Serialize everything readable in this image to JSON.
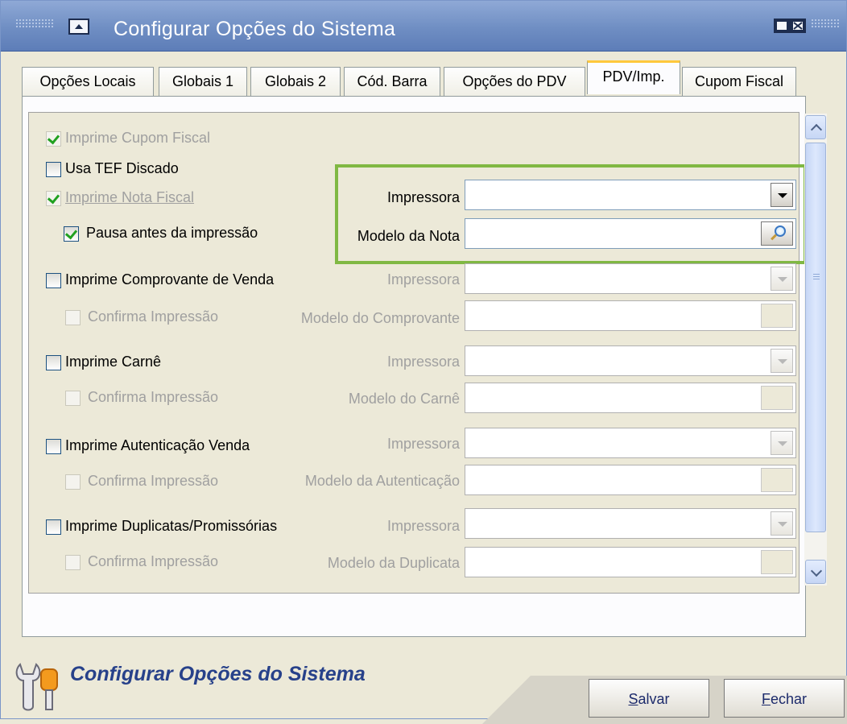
{
  "window": {
    "title": "Configurar Opções do Sistema"
  },
  "tabs": [
    {
      "label": "Opções Locais",
      "active": false
    },
    {
      "label": "Globais 1",
      "active": false
    },
    {
      "label": "Globais 2",
      "active": false
    },
    {
      "label": "Cód. Barra",
      "active": false
    },
    {
      "label": "Opções do PDV",
      "active": false
    },
    {
      "label": "PDV/Imp.",
      "active": true
    },
    {
      "label": "Cupom Fiscal",
      "active": false
    }
  ],
  "options": {
    "imprime_cupom_fiscal": {
      "label": "Imprime Cupom Fiscal",
      "checked": true,
      "enabled": false
    },
    "usa_tef_discado": {
      "label": "Usa TEF Discado",
      "checked": false,
      "enabled": true
    },
    "imprime_nota_fiscal": {
      "label": "Imprime Nota Fiscal",
      "checked": true,
      "enabled": false
    },
    "pausa_antes": {
      "label": "Pausa antes da impressão",
      "checked": true,
      "enabled": true
    },
    "nota_impressora_label": "Impressora",
    "nota_modelo_label": "Modelo da Nota",
    "nota_impressora_value": "",
    "nota_modelo_value": "",
    "comprovante": {
      "label": "Imprime Comprovante de Venda",
      "checked": false
    },
    "comprovante_confirma": {
      "label": "Confirma Impressão",
      "checked": false
    },
    "comprovante_impressora_label": "Impressora",
    "comprovante_modelo_label": "Modelo do Comprovante",
    "carne": {
      "label": "Imprime Carnê",
      "checked": false
    },
    "carne_confirma": {
      "label": "Confirma Impressão",
      "checked": false
    },
    "carne_impressora_label": "Impressora",
    "carne_modelo_label": "Modelo do Carnê",
    "autenticacao": {
      "label": "Imprime Autenticação Venda",
      "checked": false
    },
    "autenticacao_confirma": {
      "label": "Confirma Impressão",
      "checked": false
    },
    "autenticacao_impressora_label": "Impressora",
    "autenticacao_modelo_label": "Modelo da Autenticação",
    "duplicatas": {
      "label": "Imprime Duplicatas/Promissórias",
      "checked": false
    },
    "duplicatas_confirma": {
      "label": "Confirma Impressão",
      "checked": false
    },
    "duplicatas_impressora_label": "Impressora",
    "duplicatas_modelo_label": "Modelo da Duplicata"
  },
  "footer": {
    "title": "Configurar Opções do Sistema",
    "salvar_key": "S",
    "salvar_rest": "alvar",
    "fechar_key": "F",
    "fechar_rest": "echar"
  },
  "colors": {
    "titlebar": "#6f8ec3",
    "highlight": "#80b843",
    "checkmark": "#21a121",
    "active_tab_accent": "#ffc83c",
    "footer_title": "#27418a"
  },
  "icons": [
    "system-menu-icon",
    "minimize-icon",
    "close-icon",
    "dropdown-arrow-icon",
    "magnifier-icon",
    "scroll-up-icon",
    "scroll-down-icon",
    "wrench-app-icon"
  ]
}
